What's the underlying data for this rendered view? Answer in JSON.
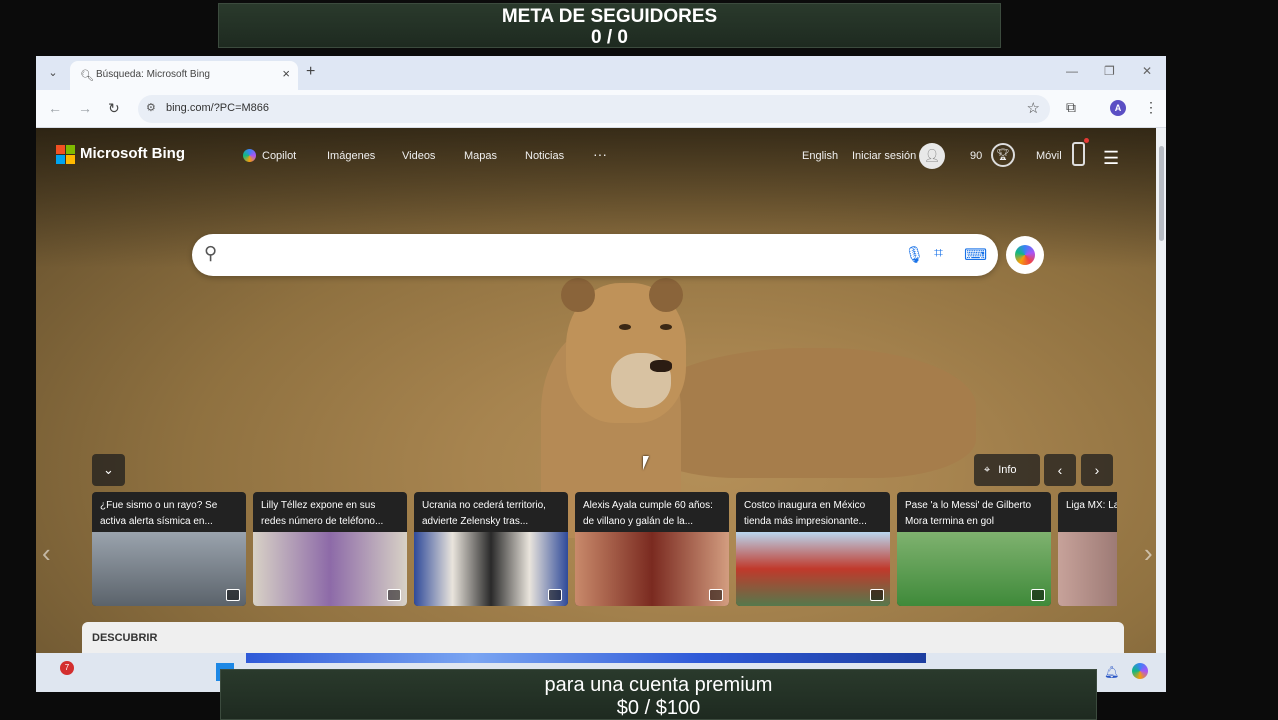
{
  "overlay_top": {
    "title": "META DE SEGUIDORES",
    "count": "0 / 0"
  },
  "overlay_bottom": {
    "title": "para una cuenta premium",
    "amount": "$0  / $100"
  },
  "browser": {
    "tab_title": "Búsqueda: Microsoft Bing",
    "url": "bing.com/?PC=M866",
    "profile_initial": "A"
  },
  "bing": {
    "logo": "Microsoft Bing",
    "nav": [
      "Copilot",
      "Imágenes",
      "Videos",
      "Mapas",
      "Noticias",
      "···"
    ],
    "language": "English",
    "signin": "Iniciar sesión",
    "rewards": "90",
    "mobile": "Móvil",
    "search_placeholder": "",
    "info_label": "Info",
    "discover_label": "DESCUBRIR",
    "news": [
      {
        "title": "¿Fue sismo o un rayo? Se activa alerta sísmica en...",
        "color": "#6e7a86"
      },
      {
        "title": "Lilly Téllez expone en sus redes número de teléfono...",
        "color": "#8a6fa8"
      },
      {
        "title": "Ucrania no cederá territorio, advierte Zelensky tras...",
        "color": "#2f4a7a"
      },
      {
        "title": "Alexis Ayala cumple 60 años: de villano y galán de la...",
        "color": "#9c5b4a"
      },
      {
        "title": "Costco inaugura en México tienda más impresionante...",
        "color": "#7d8f9c"
      },
      {
        "title": "Pase 'a lo Messi' de Gilberto Mora termina en gol",
        "color": "#4f8d45"
      },
      {
        "title": "Liga MX: La palabras de",
        "color": "#8a5a5a"
      }
    ]
  },
  "taskbar": {
    "notification_count": "7"
  }
}
